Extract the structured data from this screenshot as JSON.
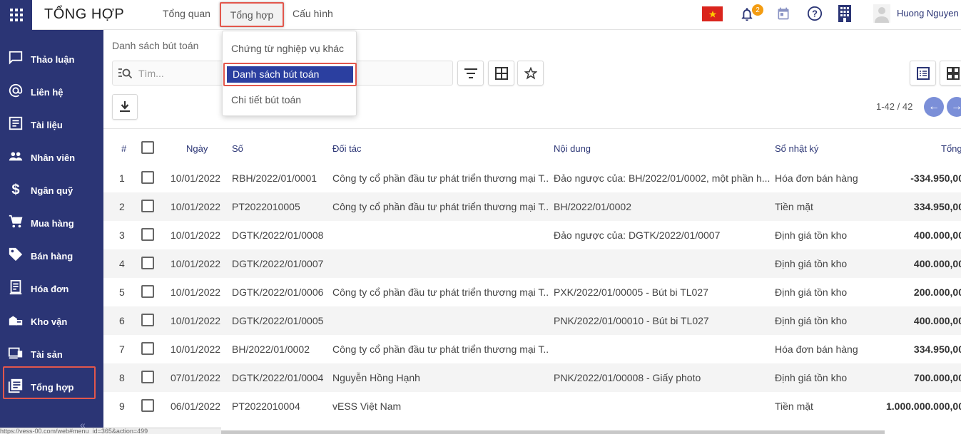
{
  "app": {
    "title": "TỔNG HỢP"
  },
  "topmenu": {
    "items": [
      "Tổng quan",
      "Tổng hợp",
      "Cấu hình"
    ]
  },
  "dropdown": {
    "items": [
      "Chứng từ nghiệp vụ khác",
      "Danh sách bút toán",
      "Chi tiết bút toán"
    ]
  },
  "systray": {
    "notification_count": "2",
    "user_name": "Huong Nguyen"
  },
  "sidebar": {
    "items": [
      {
        "label": "Thảo luận",
        "icon": "chat-icon"
      },
      {
        "label": "Liên hệ",
        "icon": "at-sign-icon"
      },
      {
        "label": "Tài liệu",
        "icon": "document-icon"
      },
      {
        "label": "Nhân viên",
        "icon": "people-icon"
      },
      {
        "label": "Ngân quỹ",
        "icon": "dollar-icon"
      },
      {
        "label": "Mua hàng",
        "icon": "cart-icon"
      },
      {
        "label": "Bán hàng",
        "icon": "tag-icon"
      },
      {
        "label": "Hóa đơn",
        "icon": "invoice-icon"
      },
      {
        "label": "Kho vận",
        "icon": "warehouse-icon"
      },
      {
        "label": "Tài sản",
        "icon": "asset-icon"
      },
      {
        "label": "Tổng hợp",
        "icon": "ledger-icon"
      }
    ],
    "collapse_label": "«"
  },
  "control": {
    "breadcrumb": "Danh sách bút toán",
    "search_placeholder": "Tìm...",
    "pager": "1-42 / 42"
  },
  "table": {
    "headers": [
      "#",
      "Ngày",
      "Số",
      "Đối tác",
      "Nội dung",
      "Sổ nhật ký",
      "Tổng"
    ],
    "rows": [
      {
        "n": "1",
        "date": "10/01/2022",
        "so": "RBH/2022/01/0001",
        "partner": "Công ty cổ phần đầu tư phát triển thương mại T...",
        "content": "Đảo ngược của: BH/2022/01/0002, một phần h...",
        "journal": "Hóa đơn bán hàng",
        "total": "-334.950,00"
      },
      {
        "n": "2",
        "date": "10/01/2022",
        "so": "PT2022010005",
        "partner": "Công ty cổ phần đầu tư phát triển thương mại T...",
        "content": "BH/2022/01/0002",
        "journal": "Tiền mặt",
        "total": "334.950,00"
      },
      {
        "n": "3",
        "date": "10/01/2022",
        "so": "DGTK/2022/01/0008",
        "partner": "",
        "content": "Đảo ngược của: DGTK/2022/01/0007",
        "journal": "Định giá tồn kho",
        "total": "400.000,00"
      },
      {
        "n": "4",
        "date": "10/01/2022",
        "so": "DGTK/2022/01/0007",
        "partner": "",
        "content": "",
        "journal": "Định giá tồn kho",
        "total": "400.000,00"
      },
      {
        "n": "5",
        "date": "10/01/2022",
        "so": "DGTK/2022/01/0006",
        "partner": "Công ty cổ phần đầu tư phát triển thương mại T...",
        "content": "PXK/2022/01/00005 - Bút bi TL027",
        "journal": "Định giá tồn kho",
        "total": "200.000,00"
      },
      {
        "n": "6",
        "date": "10/01/2022",
        "so": "DGTK/2022/01/0005",
        "partner": "",
        "content": "PNK/2022/01/00010 - Bút bi TL027",
        "journal": "Định giá tồn kho",
        "total": "400.000,00"
      },
      {
        "n": "7",
        "date": "10/01/2022",
        "so": "BH/2022/01/0002",
        "partner": "Công ty cổ phần đầu tư phát triển thương mại T...",
        "content": "",
        "journal": "Hóa đơn bán hàng",
        "total": "334.950,00"
      },
      {
        "n": "8",
        "date": "07/01/2022",
        "so": "DGTK/2022/01/0004",
        "partner": "Nguyễn Hồng Hạnh",
        "content": "PNK/2022/01/00008 - Giấy photo",
        "journal": "Định giá tồn kho",
        "total": "700.000,00"
      },
      {
        "n": "9",
        "date": "06/01/2022",
        "so": "PT2022010004",
        "partner": "vESS Việt Nam",
        "content": "",
        "journal": "Tiền mặt",
        "total": "1.000.000.000,00"
      }
    ]
  },
  "statusbar": {
    "url": "https://vess-00.com/web#menu_id=365&action=499"
  },
  "colors": {
    "primary": "#2b3575",
    "highlight": "#e2574c",
    "active_item": "#2b3fa0"
  }
}
